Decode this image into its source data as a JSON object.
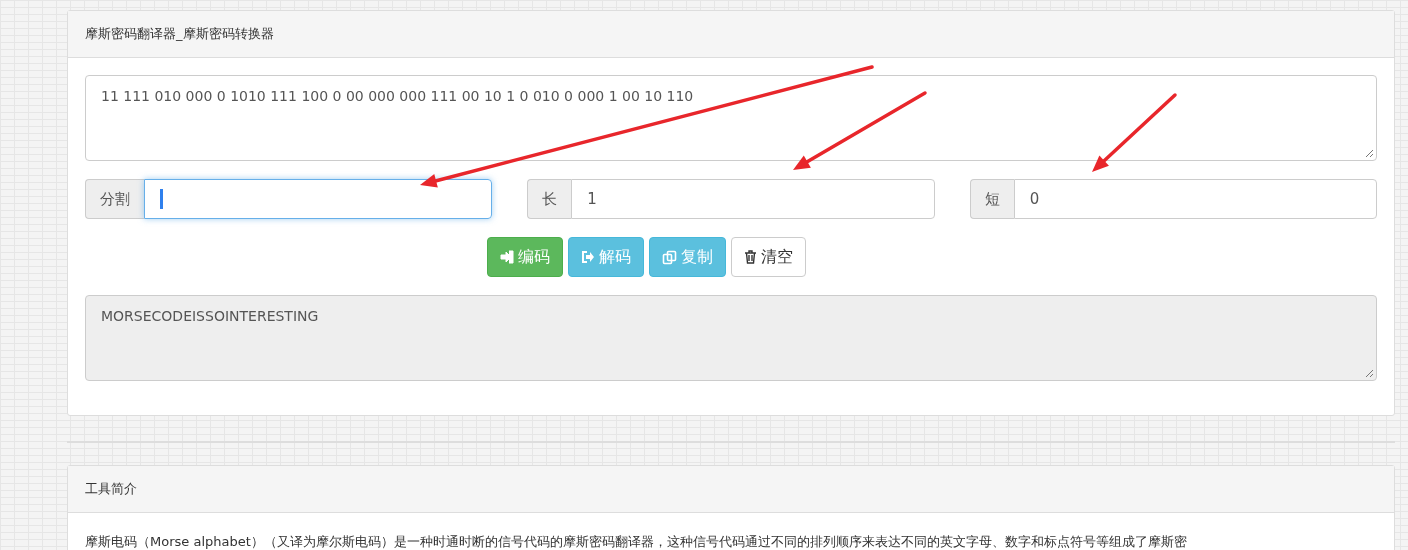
{
  "converter": {
    "title": "摩斯密码翻译器_摩斯密码转换器",
    "input": {
      "value": "11 111 010 000 0 1010 111 100 0 00 000 000 111 00 10 1 0 010 0 000 1 00 10 110"
    },
    "fields": [
      {
        "label": "分割",
        "focused": true
      },
      {
        "label": "长",
        "value": "1",
        "focused": false
      },
      {
        "label": "短",
        "value": "0",
        "focused": false
      }
    ],
    "buttons": [
      {
        "label": "编码",
        "kind": "encode"
      },
      {
        "label": "解码",
        "kind": "decode"
      },
      {
        "label": "复制",
        "kind": "copy"
      },
      {
        "label": "清空",
        "kind": "clear"
      }
    ],
    "output": {
      "value": "MORSECODEISSOINTERESTING"
    }
  },
  "intro": {
    "title": "工具简介",
    "text": "摩斯电码（Morse alphabet）（又译为摩尔斯电码）是一种时通时断的信号代码的摩斯密码翻译器，这种信号代码通过不同的排列顺序来表达不同的英文字母、数字和标点符号等组成了摩斯密"
  }
}
